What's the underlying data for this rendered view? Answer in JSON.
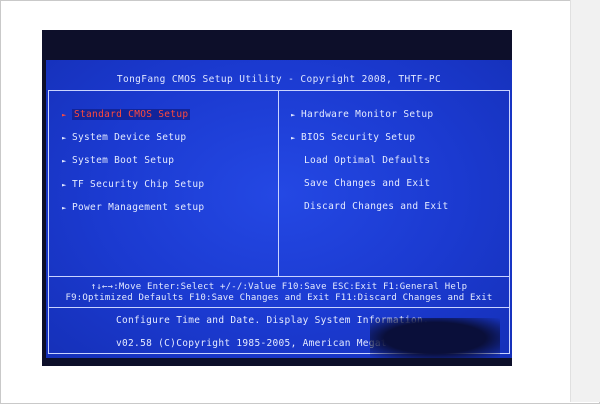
{
  "bios": {
    "title": "TongFang CMOS Setup Utility - Copyright 2008, THTF-PC",
    "left_menu": [
      {
        "label": "Standard CMOS Setup",
        "selected": true
      },
      {
        "label": "System Device Setup",
        "selected": false
      },
      {
        "label": "System Boot Setup",
        "selected": false
      },
      {
        "label": "TF Security Chip Setup",
        "selected": false
      },
      {
        "label": "Power Management setup",
        "selected": false
      }
    ],
    "right_menu": [
      {
        "label": "Hardware Monitor Setup",
        "has_arrow": true
      },
      {
        "label": "BIOS Security Setup",
        "has_arrow": true
      },
      {
        "label": "Load Optimal Defaults",
        "has_arrow": false
      },
      {
        "label": "Save Changes and Exit",
        "has_arrow": false
      },
      {
        "label": "Discard Changes and Exit",
        "has_arrow": false
      }
    ],
    "arrow_glyph": "►",
    "help_line_1": "↑↓←→:Move  Enter:Select  +/-/:Value  F10:Save  ESC:Exit  F1:General Help",
    "help_line_2": "F9:Optimized Defaults F10:Save Changes and Exit F11:Discard Changes and Exit",
    "status": "Configure Time and Date.  Display System Information.",
    "copyright": "v02.58 (C)Copyright 1985-2005, American Megat"
  },
  "colors": {
    "screen_blue": "#1b3ad0",
    "text": "#e4eaff",
    "highlight_red": "#ff4a3c",
    "frame_line": "#c9d3ff"
  }
}
